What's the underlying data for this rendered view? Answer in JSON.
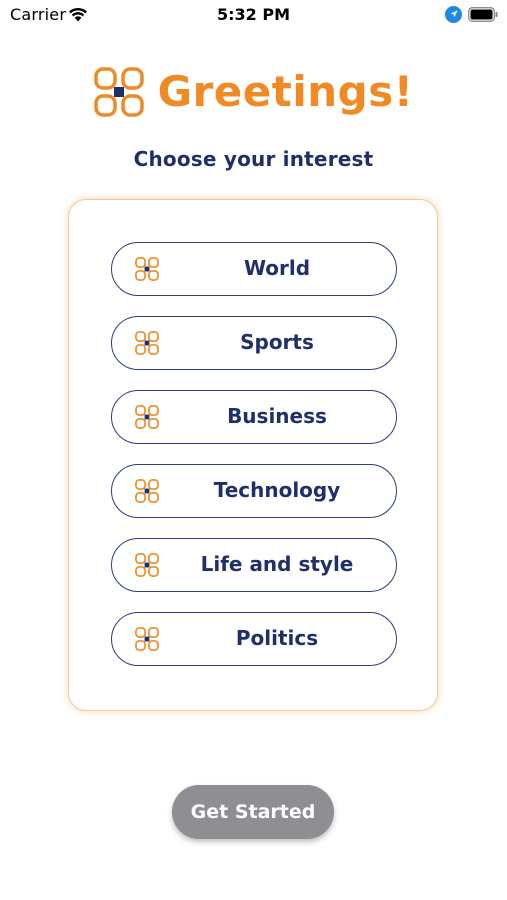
{
  "status_bar": {
    "carrier": "Carrier",
    "time": "5:32 PM",
    "icons": [
      "wifi-icon",
      "location-arrow-icon",
      "battery-icon"
    ]
  },
  "header": {
    "title": "Greetings!",
    "logo_icon": "grid-logo-icon"
  },
  "subtitle": "Choose your interest",
  "interests": [
    {
      "label": "World",
      "icon": "grid-logo-icon"
    },
    {
      "label": "Sports",
      "icon": "grid-logo-icon"
    },
    {
      "label": "Business",
      "icon": "grid-logo-icon"
    },
    {
      "label": "Technology",
      "icon": "grid-logo-icon"
    },
    {
      "label": "Life and style",
      "icon": "grid-logo-icon"
    },
    {
      "label": "Politics",
      "icon": "grid-logo-icon"
    }
  ],
  "cta": {
    "label": "Get Started"
  },
  "colors": {
    "accent": "#F08A24",
    "navy": "#1F2F6B",
    "button_border": "#2C3E7A",
    "cta_background": "#8E8E93",
    "location_blue": "#1E88E5"
  }
}
